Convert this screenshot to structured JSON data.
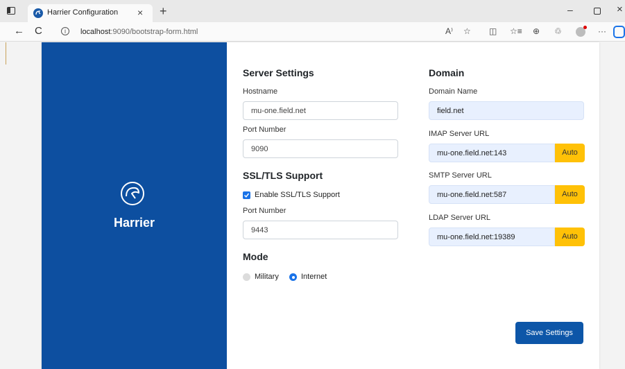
{
  "browser": {
    "tab_title": "Harrier Configuration",
    "tab_close": "×",
    "new_tab": "+",
    "url_host": "localhost",
    "url_rest": ":9090/bootstrap-form.html",
    "toolbar_icons": [
      "read-aloud-icon",
      "favorite-icon",
      "split-screen-icon",
      "favorites-icon",
      "collections-icon",
      "extensions-icon",
      "profile-icon",
      "more-icon"
    ],
    "win_min": "–",
    "win_close": "×",
    "back": "←",
    "reload": "C",
    "info": "i",
    "read_aloud": "A⁾",
    "star": "☆",
    "split": "◫",
    "favs": "☆≡",
    "collections": "⊕",
    "ext": "♲",
    "more": "···"
  },
  "brand": {
    "name": "Harrier",
    "color": "#0d4fa0"
  },
  "server_settings": {
    "heading": "Server Settings",
    "hostname_label": "Hostname",
    "hostname_value": "mu-one.field.net",
    "port_label": "Port Number",
    "port_value": "9090"
  },
  "ssl": {
    "heading": "SSL/TLS Support",
    "enable_label": "Enable SSL/TLS Support",
    "enabled": true,
    "port_label": "Port Number",
    "port_value": "9443"
  },
  "mode": {
    "heading": "Mode",
    "options": [
      "Military",
      "Internet"
    ],
    "selected": "Internet"
  },
  "domain": {
    "heading": "Domain",
    "name_label": "Domain Name",
    "name_value": "field.net",
    "imap_label": "IMAP Server URL",
    "imap_value": "mu-one.field.net:143",
    "smtp_label": "SMTP Server URL",
    "smtp_value": "mu-one.field.net:587",
    "ldap_label": "LDAP Server URL",
    "ldap_value": "mu-one.field.net:19389",
    "auto_label": "Auto",
    "auto_color": "#ffc107"
  },
  "actions": {
    "save_label": "Save Settings",
    "save_color": "#0d56a8"
  }
}
